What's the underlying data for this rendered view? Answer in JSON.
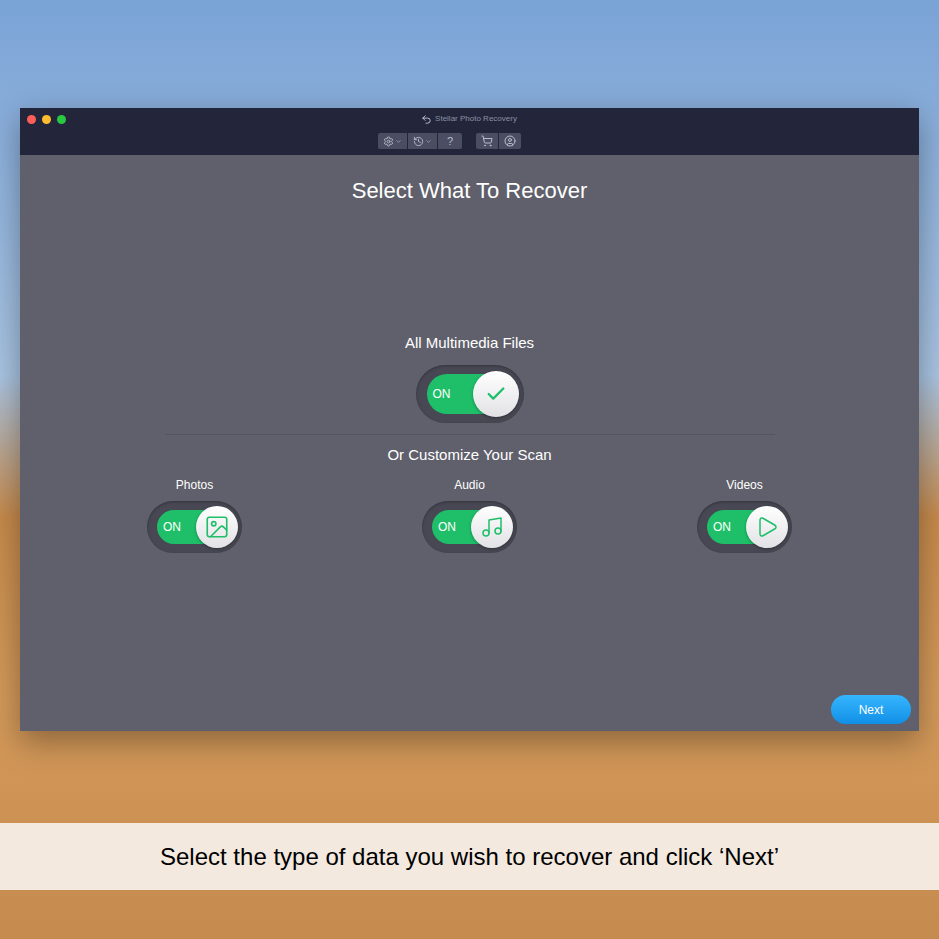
{
  "window": {
    "title": "Stellar Photo Recovery"
  },
  "toolbar": {
    "help_label": "?"
  },
  "heading": "Select What To Recover",
  "all_media": {
    "label": "All Multimedia Files",
    "on": true,
    "status": "ON"
  },
  "customize_label": "Or Customize Your Scan",
  "options": [
    {
      "label": "Photos",
      "on": true,
      "status": "ON",
      "kind": "photo"
    },
    {
      "label": "Audio",
      "on": true,
      "status": "ON",
      "kind": "audio"
    },
    {
      "label": "Videos",
      "on": true,
      "status": "ON",
      "kind": "video"
    }
  ],
  "next_button": "Next",
  "caption": "Select the type of data you wish to recover and click ‘Next’"
}
